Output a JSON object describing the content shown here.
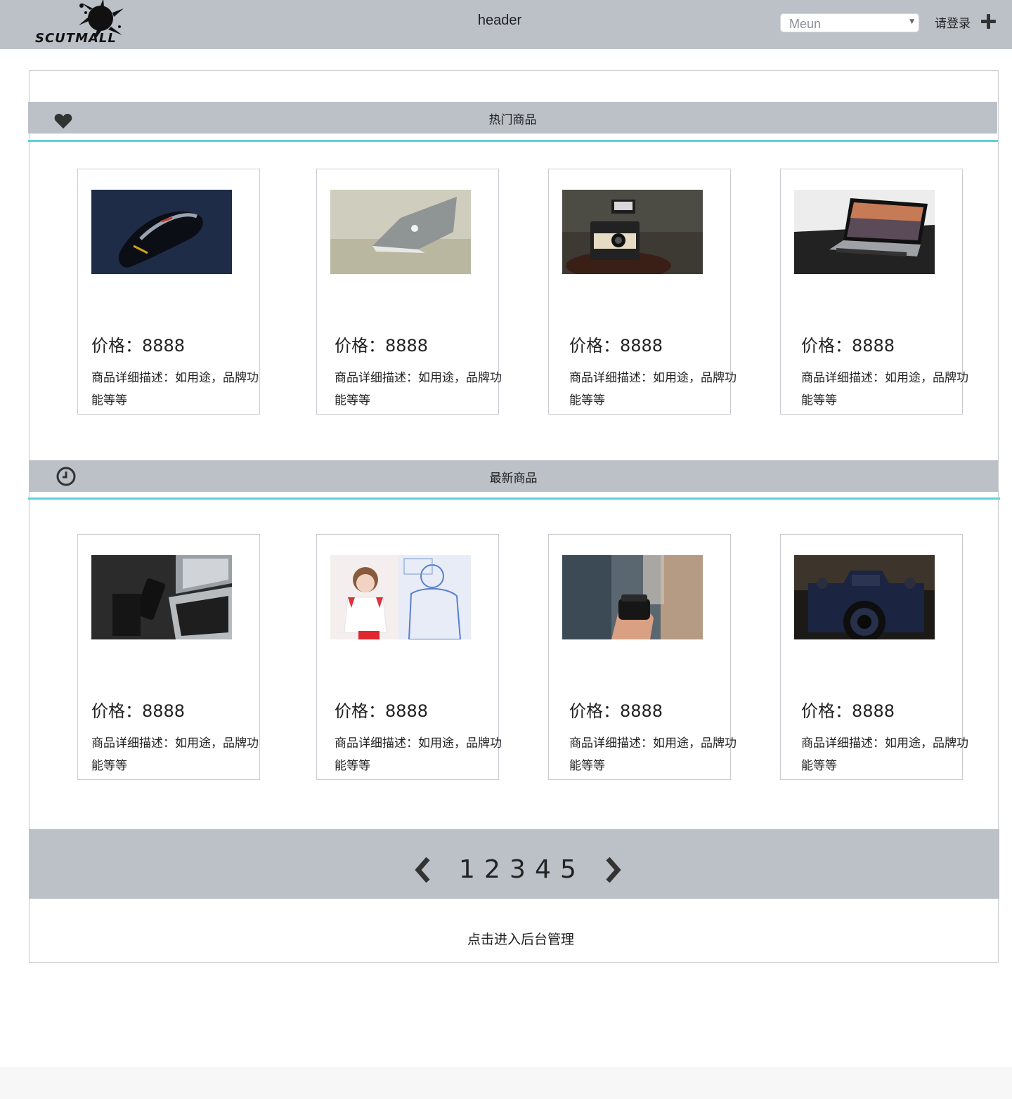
{
  "header": {
    "logo_text": "SCUTMALL",
    "title": "header",
    "menu_value": "Meun",
    "login_label": "请登录",
    "add_icon": "plus-icon"
  },
  "hot": {
    "title": "热门商品",
    "icon": "heart-icon",
    "products": [
      {
        "price": "价格：8888",
        "desc": "商品详细描述：如用途，品牌功能等等",
        "image": "computer mouse photo"
      },
      {
        "price": "价格：8888",
        "desc": "商品详细描述：如用途，品牌功能等等",
        "image": "laptop photo"
      },
      {
        "price": "价格：8888",
        "desc": "商品详细描述：如用途，品牌功能等等",
        "image": "instant camera photo"
      },
      {
        "price": "价格：8888",
        "desc": "商品详细描述：如用途，品牌功能等等",
        "image": "laptop on table photo"
      }
    ]
  },
  "new": {
    "title": "最新商品",
    "icon": "clock-icon",
    "products": [
      {
        "price": "价格：8888",
        "desc": "商品详细描述：如用途，品牌功能等等",
        "image": "phone and laptop photo"
      },
      {
        "price": "价格：8888",
        "desc": "商品详细描述：如用途，品牌功能等等",
        "image": "illustration photo"
      },
      {
        "price": "价格：8888",
        "desc": "商品详细描述：如用途，品牌功能等等",
        "image": "camera lens photo"
      },
      {
        "price": "价格：8888",
        "desc": "商品详细描述：如用途，品牌功能等等",
        "image": "mirrorless camera photo"
      }
    ]
  },
  "pagination": {
    "pages": [
      "1",
      "2",
      "3",
      "4",
      "5"
    ],
    "prev_icon": "chevron-left-icon",
    "next_icon": "chevron-right-icon"
  },
  "admin_link": "点击进入后台管理",
  "colors": {
    "bar": "#bcc1c8",
    "accent_line": "#5ed1d9"
  }
}
